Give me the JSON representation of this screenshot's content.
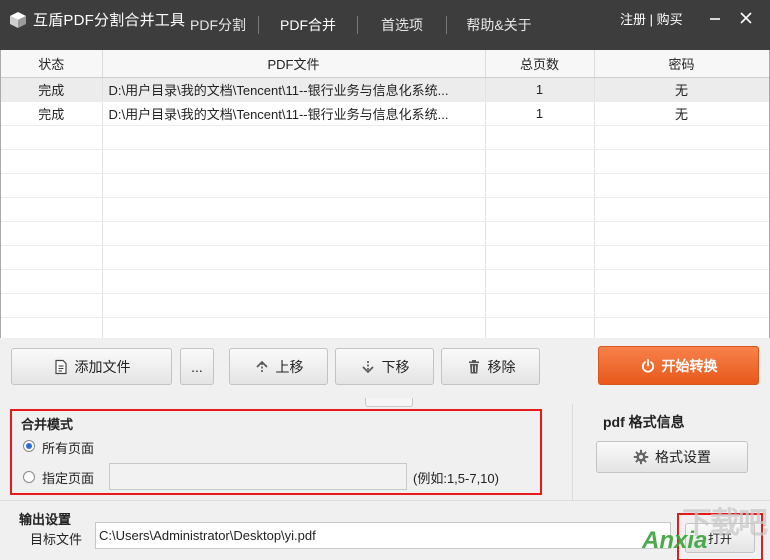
{
  "app": {
    "title": "互盾PDF分割合并工具",
    "tabs": [
      "PDF分割",
      "PDF合并",
      "首选项",
      "帮助&关于"
    ],
    "active_tab": "PDF合并",
    "links": {
      "register": "注册",
      "sep": " | ",
      "buy": "购买"
    },
    "icons": {
      "logo": "cube-logo-icon",
      "minimize": "minimize-icon",
      "close": "close-icon"
    }
  },
  "table": {
    "columns": [
      "状态",
      "PDF文件",
      "总页数",
      "密码"
    ],
    "rows": [
      {
        "status": "完成",
        "file": "D:\\用户目录\\我的文档\\Tencent\\11--银行业务与信息化系统...",
        "pages": "1",
        "password": "无"
      },
      {
        "status": "完成",
        "file": "D:\\用户目录\\我的文档\\Tencent\\11--银行业务与信息化系统...",
        "pages": "1",
        "password": "无"
      }
    ]
  },
  "toolbar": {
    "add_file": "添加文件",
    "more": "...",
    "move_up": "上移",
    "move_down": "下移",
    "remove": "移除",
    "start": "开始转换",
    "icons": {
      "add": "document-icon",
      "up": "arrow-up-icon",
      "down": "arrow-down-icon",
      "remove": "trash-icon",
      "start": "power-icon"
    }
  },
  "merge": {
    "title": "合并模式",
    "option_all": "所有页面",
    "option_specific": "指定页面",
    "selected": "所有页面",
    "range_value": "",
    "range_hint": "(例如:1,5-7,10)"
  },
  "pdf_format": {
    "title": "pdf 格式信息",
    "button": "格式设置",
    "icon": "gear-icon"
  },
  "output": {
    "title": "输出设置",
    "target_label": "目标文件",
    "target_value": "C:\\Users\\Administrator\\Desktop\\yi.pdf",
    "open_button": "打开"
  },
  "watermark": {
    "cn": "下载吧",
    "en": "Anxia"
  },
  "colors": {
    "accent": "#ee6a2e",
    "highlight": "#e31b1b",
    "titlebar": "#3d3d3d"
  }
}
